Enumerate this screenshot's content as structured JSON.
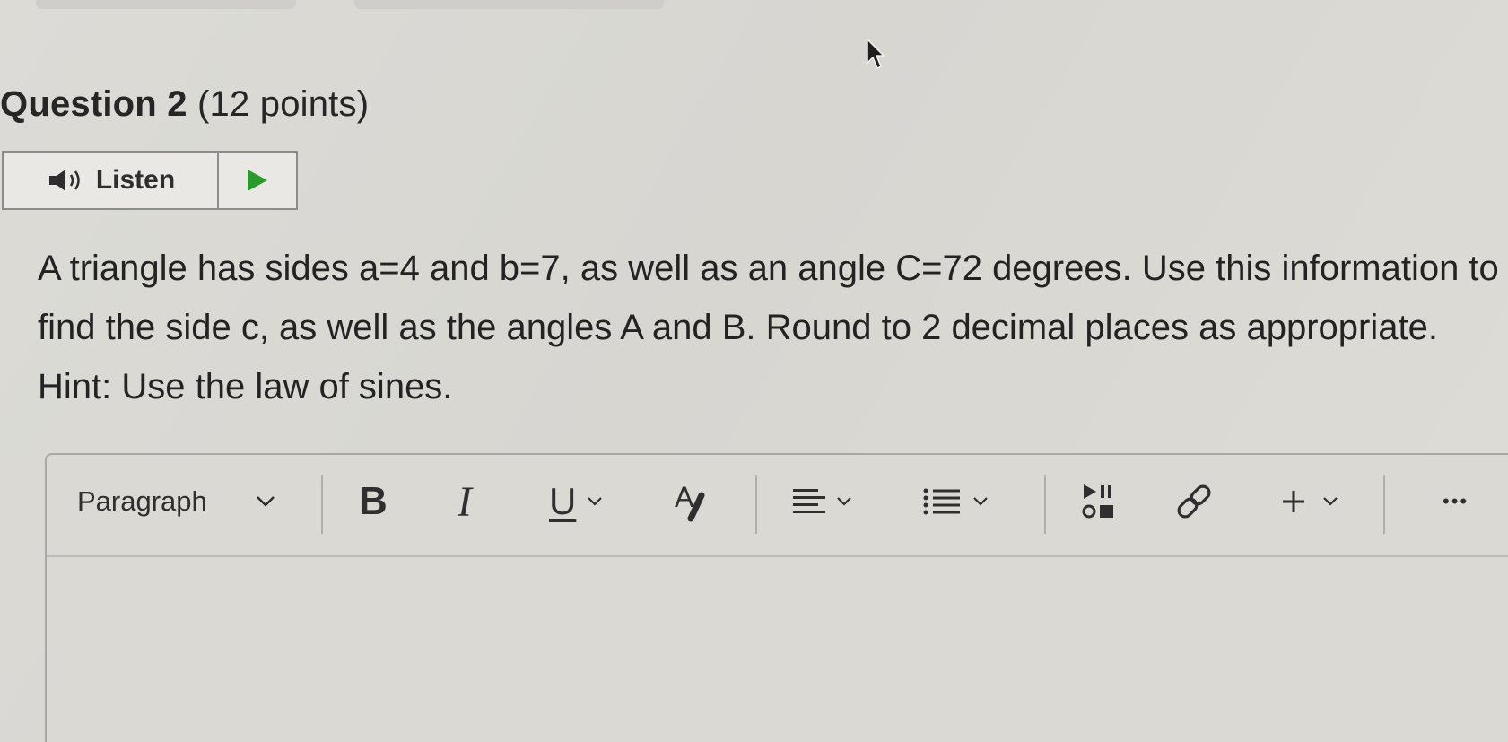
{
  "question": {
    "title": "Question 2",
    "points": "(12 points)",
    "text": "A triangle has sides a=4 and b=7, as well as an angle C=72 degrees.  Use this information to find the side c, as well as the angles A and B.  Round to 2 decimal places as appropriate. Hint: Use the law of sines."
  },
  "listen": {
    "label": "Listen",
    "icon": "speaker-icon",
    "play_icon": "play-icon"
  },
  "editor": {
    "block_format": "Paragraph",
    "toolbar_icons": [
      "bold-icon",
      "italic-icon",
      "underline-icon",
      "text-color-icon",
      "align-icon",
      "list-icon",
      "media-icon",
      "link-icon",
      "plus-icon",
      "more-icon"
    ],
    "bold_label": "B",
    "italic_label": "I",
    "underline_label": "U",
    "text_color_label": "A",
    "more_label": "•••",
    "body": ""
  },
  "colors": {
    "background": "#d9d8d3",
    "text": "#262626",
    "border": "#8c8c8c"
  }
}
